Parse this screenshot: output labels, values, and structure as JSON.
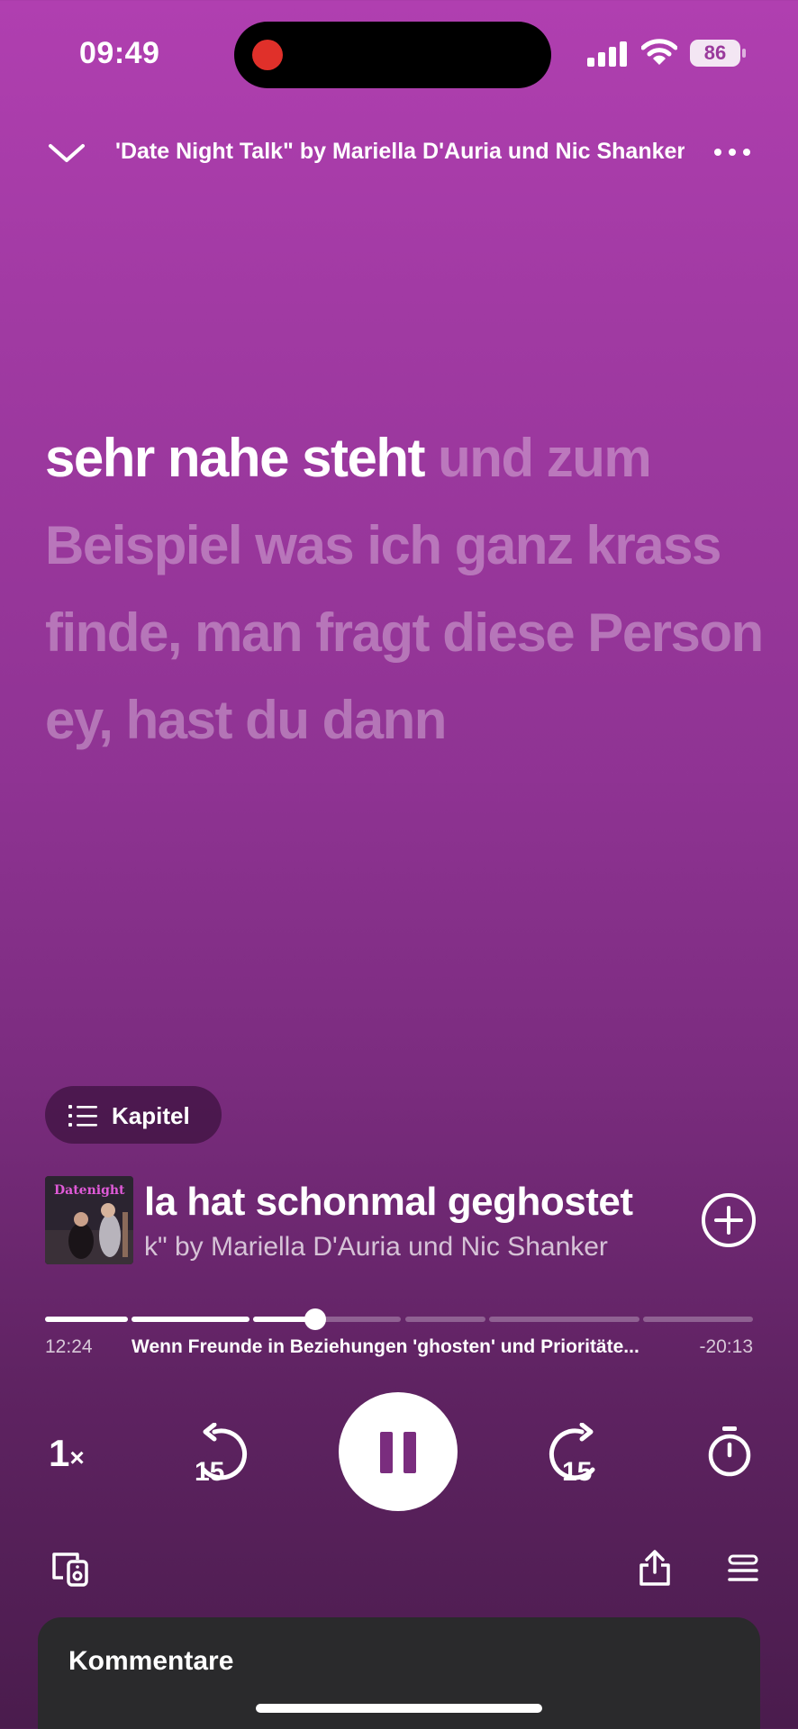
{
  "status_bar": {
    "time": "09:49",
    "battery": "86"
  },
  "header": {
    "title": "'Date Night Talk\" by Mariella D'Auria und Nic Shanker"
  },
  "lyrics": {
    "active": "sehr nahe steht",
    "upcoming": "und zum Beispiel was ich ganz krass finde, man fragt diese Person ey, hast du dann"
  },
  "chapters_button": {
    "label": "Kapitel"
  },
  "now_playing": {
    "cover_text": "Datenight",
    "title": "la hat schonmal geghostet",
    "subtitle": "k\" by Mariella D'Auria und Nic Shanker"
  },
  "progress": {
    "elapsed": "12:24",
    "remaining": "-20:13",
    "chapter": "Wenn Freunde in Beziehungen 'ghosten' und Prioritäte...",
    "fraction": 0.385
  },
  "controls": {
    "speed": "1",
    "speed_suffix": "×",
    "skip_back": "15",
    "skip_forward": "15"
  },
  "comments": {
    "title": "Kommentare"
  },
  "colors": {
    "gradient_top": "#b03fb0",
    "gradient_bottom": "#4a1c4d",
    "pause_icon": "#7a2d7e",
    "sheet": "#2a2a2c"
  },
  "icons": [
    "chevron-down-icon",
    "more-icon",
    "list-icon",
    "add-circle-icon",
    "skip-back-15-icon",
    "pause-icon",
    "skip-forward-15-icon",
    "sleep-timer-icon",
    "devices-icon",
    "share-icon",
    "queue-icon"
  ]
}
